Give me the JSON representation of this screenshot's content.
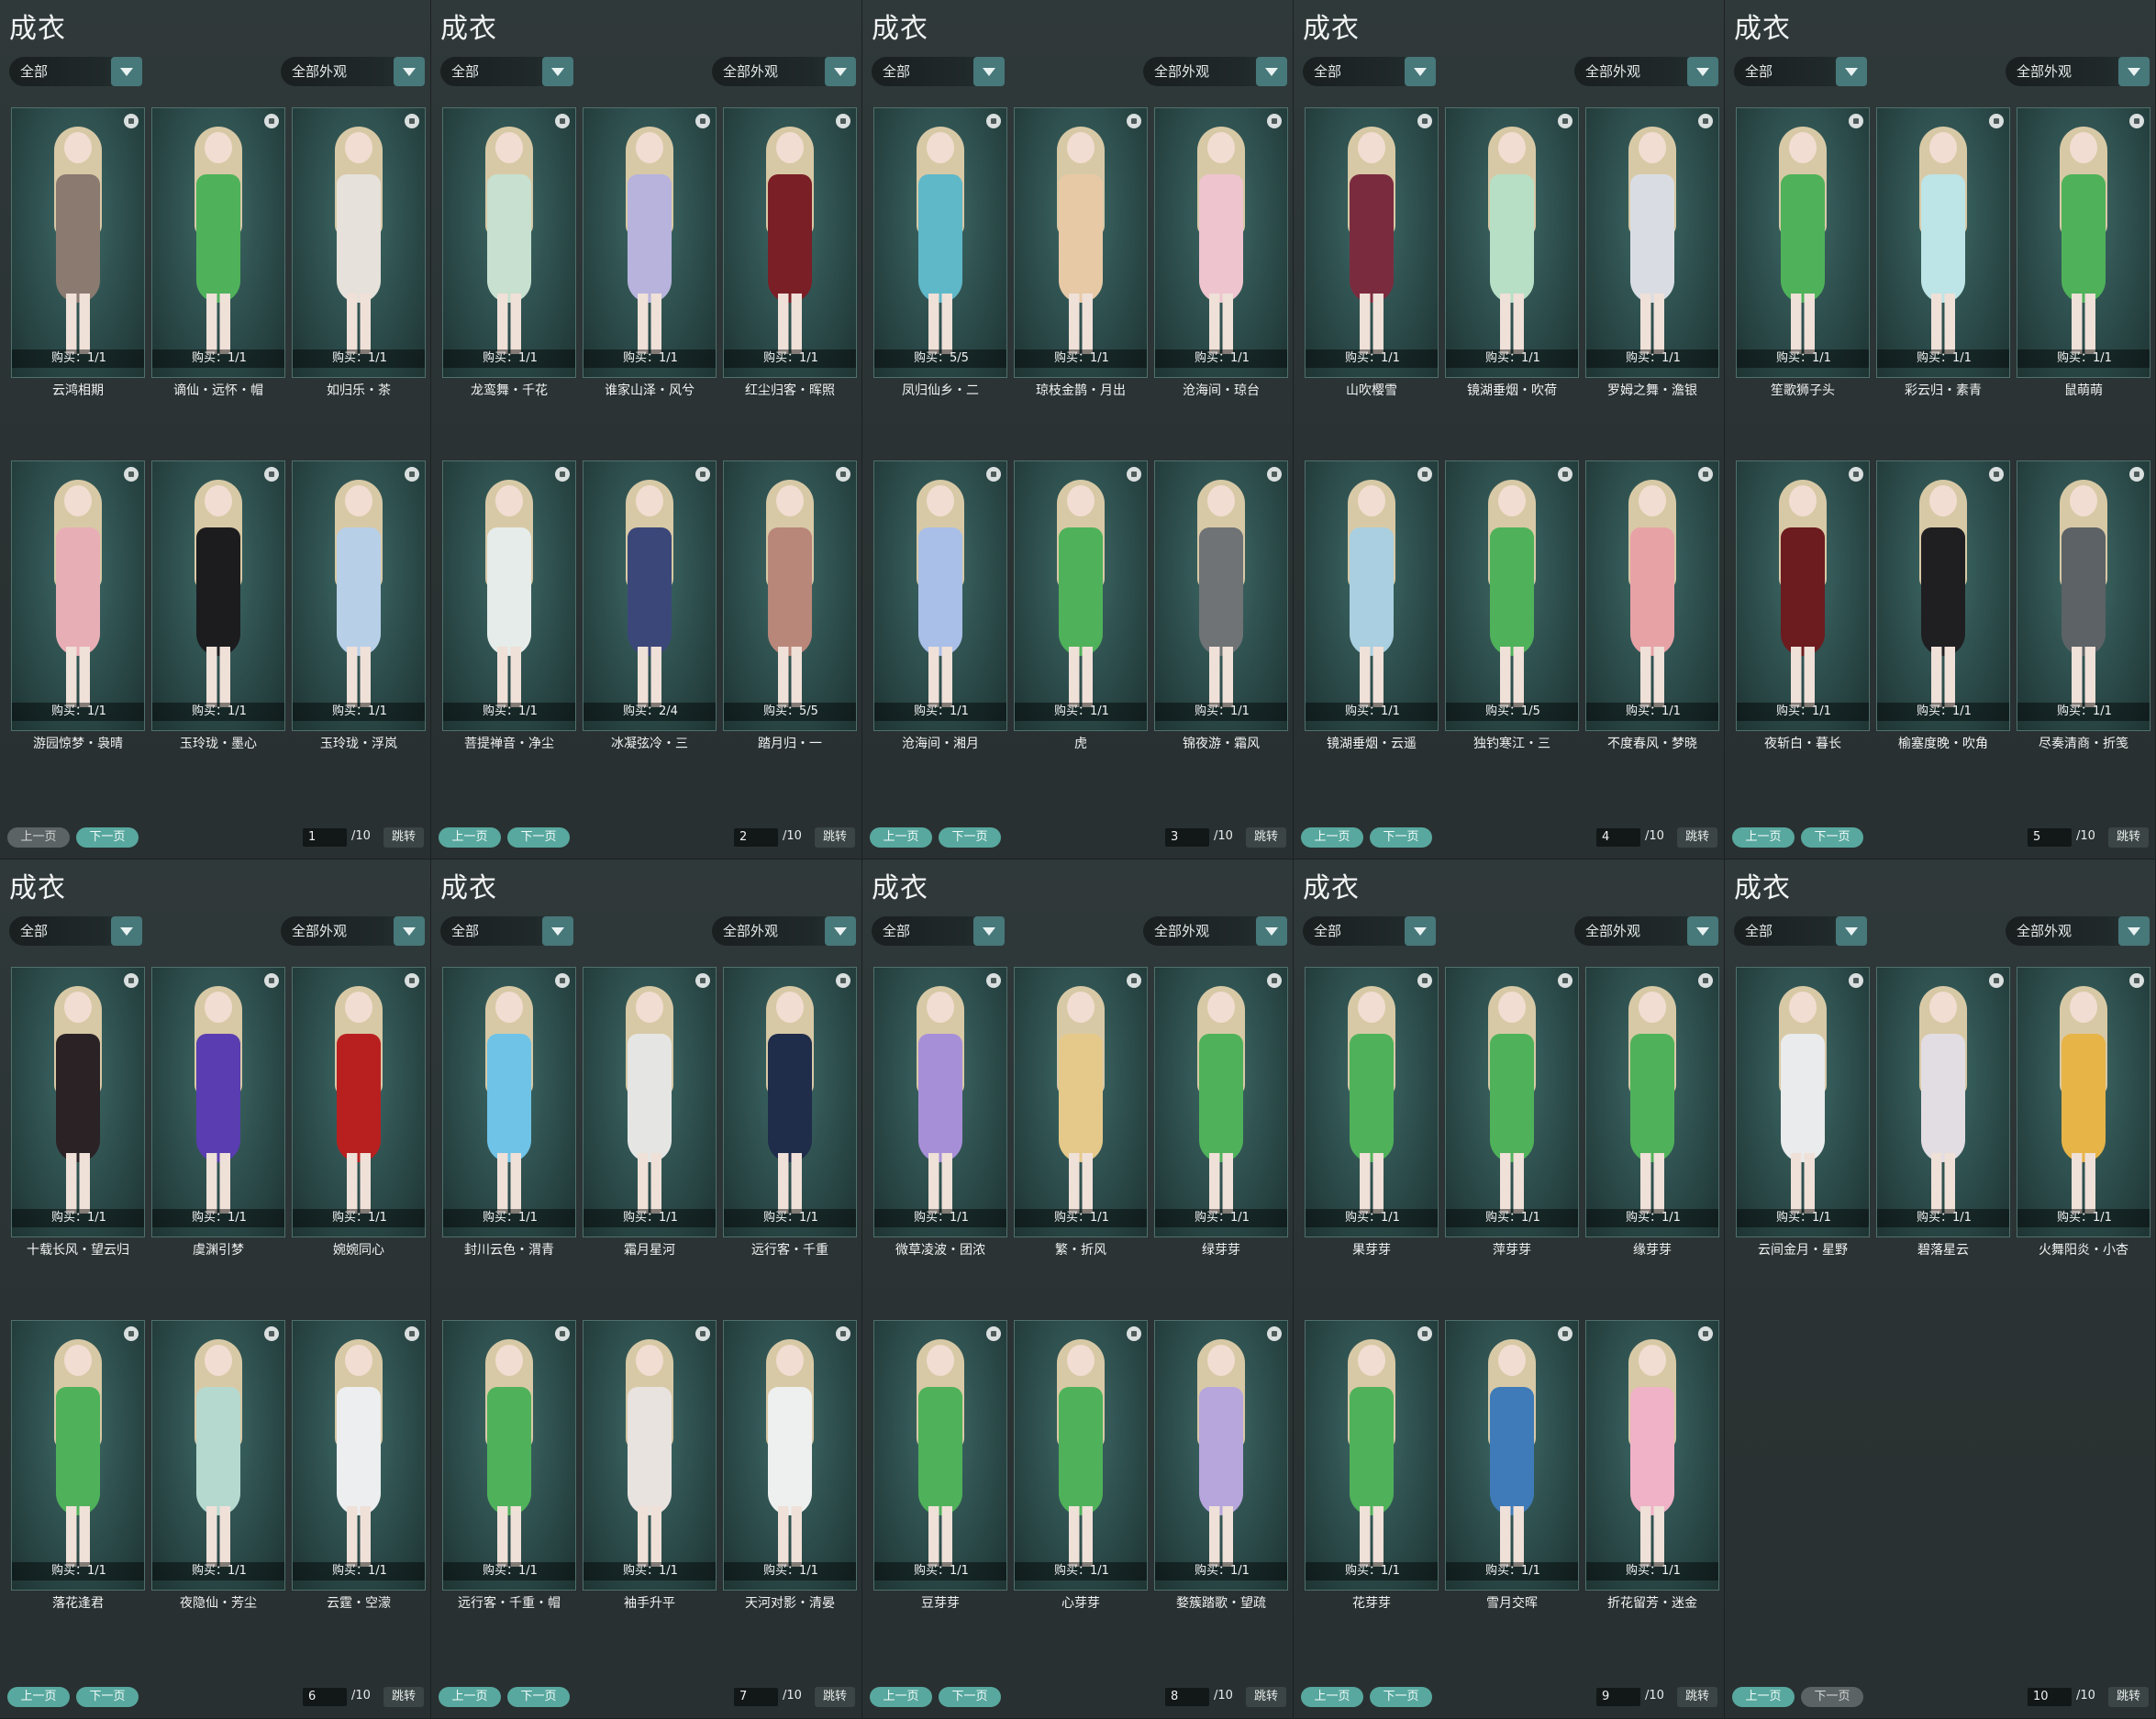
{
  "colors": {
    "accent_on": "#58a89f",
    "accent_off": "#5c6364",
    "dropdown_arrow": "#47787a"
  },
  "labels": {
    "title": "成衣",
    "filter_left": "全部",
    "filter_right": "全部外观",
    "prev": "上一页",
    "next": "下一页",
    "total": "/10",
    "jump": "跳转"
  },
  "pages": [
    {
      "page": "1",
      "prev_enabled": false,
      "next_enabled": true,
      "items": [
        {
          "name": "云鸿相期",
          "buy": "购买：1/1",
          "outfit": "#8a7a70"
        },
        {
          "name": "谪仙・远怀・帽",
          "buy": "购买：1/1",
          "outfit": "#4fb25a"
        },
        {
          "name": "如归乐・茶",
          "buy": "购买：1/1",
          "outfit": "#e6e1da"
        },
        {
          "name": "游园惊梦・袅晴",
          "buy": "购买：1/1",
          "outfit": "#e8aeb6"
        },
        {
          "name": "玉玲珑・墨心",
          "buy": "购买：1/1",
          "outfit": "#1c1c1f"
        },
        {
          "name": "玉玲珑・浮岚",
          "buy": "购买：1/1",
          "outfit": "#b8cfe8"
        }
      ]
    },
    {
      "page": "2",
      "prev_enabled": true,
      "next_enabled": true,
      "items": [
        {
          "name": "龙鸾舞・千花",
          "buy": "购买：1/1",
          "outfit": "#c8e0cf"
        },
        {
          "name": "谁家山泽・风兮",
          "buy": "购买：1/1",
          "outfit": "#b7b3dd"
        },
        {
          "name": "红尘归客・晖照",
          "buy": "购买：1/1",
          "outfit": "#7a1f25"
        },
        {
          "name": "菩提禅音・净尘",
          "buy": "购买：1/1",
          "outfit": "#e6ece9"
        },
        {
          "name": "冰凝弦冷・三",
          "buy": "购买：2/4",
          "outfit": "#3b4778"
        },
        {
          "name": "踏月归・一",
          "buy": "购买：5/5",
          "outfit": "#b9877a"
        }
      ]
    },
    {
      "page": "3",
      "prev_enabled": true,
      "next_enabled": true,
      "items": [
        {
          "name": "凤归仙乡・二",
          "buy": "购买：5/5",
          "outfit": "#5fb8c8"
        },
        {
          "name": "琼枝金鹊・月出",
          "buy": "购买：1/1",
          "outfit": "#e7c9a6"
        },
        {
          "name": "沧海间・琼台",
          "buy": "购买：1/1",
          "outfit": "#eec4cf"
        },
        {
          "name": "沧海间・湘月",
          "buy": "购买：1/1",
          "outfit": "#a9bfe8"
        },
        {
          "name": "虎",
          "buy": "购买：1/1",
          "outfit": "#4fb25a"
        },
        {
          "name": "锦夜游・霜风",
          "buy": "购买：1/1",
          "outfit": "#6f7376"
        }
      ]
    },
    {
      "page": "4",
      "prev_enabled": true,
      "next_enabled": true,
      "items": [
        {
          "name": "山吹樱雪",
          "buy": "购买：1/1",
          "outfit": "#7b2b3e"
        },
        {
          "name": "镜湖垂烟・吹荷",
          "buy": "购买：1/1",
          "outfit": "#b7dfc5"
        },
        {
          "name": "罗姆之舞・澹银",
          "buy": "购买：1/1",
          "outfit": "#d9dde3"
        },
        {
          "name": "镜湖垂烟・云遥",
          "buy": "购买：1/1",
          "outfit": "#a9cfe0"
        },
        {
          "name": "独钓寒江・三",
          "buy": "购买：1/5",
          "outfit": "#4fb25a"
        },
        {
          "name": "不度春风・梦晓",
          "buy": "购买：1/1",
          "outfit": "#e7a2a6"
        }
      ]
    },
    {
      "page": "5",
      "prev_enabled": true,
      "next_enabled": true,
      "items": [
        {
          "name": "笙歌狮子头",
          "buy": "购买：1/1",
          "outfit": "#4fb25a"
        },
        {
          "name": "彩云归・素青",
          "buy": "购买：1/1",
          "outfit": "#bde4e6"
        },
        {
          "name": "鼠萌萌",
          "buy": "购买：1/1",
          "outfit": "#4fb25a"
        },
        {
          "name": "夜斩白・暮长",
          "buy": "购买：1/1",
          "outfit": "#6c1b1f"
        },
        {
          "name": "榆塞度晚・吹角",
          "buy": "购买：1/1",
          "outfit": "#1f1f22"
        },
        {
          "name": "尽奏清商・折笺",
          "buy": "购买：1/1",
          "outfit": "#5c6266"
        }
      ]
    },
    {
      "page": "6",
      "prev_enabled": true,
      "next_enabled": true,
      "items": [
        {
          "name": "十载长风・望云归",
          "buy": "购买：1/1",
          "outfit": "#2a2225"
        },
        {
          "name": "虞渊引梦",
          "buy": "购买：1/1",
          "outfit": "#5a3db0"
        },
        {
          "name": "婉婉同心",
          "buy": "购买：1/1",
          "outfit": "#b8201f"
        },
        {
          "name": "落花逢君",
          "buy": "购买：1/1",
          "outfit": "#4fb25a"
        },
        {
          "name": "夜隐仙・芳尘",
          "buy": "购买：1/1",
          "outfit": "#b6d9cf"
        },
        {
          "name": "云霆・空濛",
          "buy": "购买：1/1",
          "outfit": "#eceeef"
        }
      ]
    },
    {
      "page": "7",
      "prev_enabled": true,
      "next_enabled": true,
      "items": [
        {
          "name": "封川云色・渭青",
          "buy": "购买：1/1",
          "outfit": "#6fc3e6"
        },
        {
          "name": "霜月星河",
          "buy": "购买：1/1",
          "outfit": "#e5e6e4"
        },
        {
          "name": "远行客・千重",
          "buy": "购买：1/1",
          "outfit": "#1f2c4a"
        },
        {
          "name": "远行客・千重・帽",
          "buy": "购买：1/1",
          "outfit": "#4fb25a"
        },
        {
          "name": "袖手升平",
          "buy": "购买：1/1",
          "outfit": "#e9e3df"
        },
        {
          "name": "天河对影・清晏",
          "buy": "购买：1/1",
          "outfit": "#eef0ef"
        }
      ]
    },
    {
      "page": "8",
      "prev_enabled": true,
      "next_enabled": true,
      "items": [
        {
          "name": "微草凌波・团浓",
          "buy": "购买：1/1",
          "outfit": "#a78fd8"
        },
        {
          "name": "繁・折风",
          "buy": "购买：1/1",
          "outfit": "#e4c98a"
        },
        {
          "name": "绿芽芽",
          "buy": "购买：1/1",
          "outfit": "#4fb25a"
        },
        {
          "name": "豆芽芽",
          "buy": "购买：1/1",
          "outfit": "#4fb25a"
        },
        {
          "name": "心芽芽",
          "buy": "购买：1/1",
          "outfit": "#4fb25a"
        },
        {
          "name": "婺簇踏歌・望疏",
          "buy": "购买：1/1",
          "outfit": "#b6a6dc"
        }
      ]
    },
    {
      "page": "9",
      "prev_enabled": true,
      "next_enabled": true,
      "items": [
        {
          "name": "果芽芽",
          "buy": "购买：1/1",
          "outfit": "#4fb25a"
        },
        {
          "name": "萍芽芽",
          "buy": "购买：1/1",
          "outfit": "#4fb25a"
        },
        {
          "name": "缘芽芽",
          "buy": "购买：1/1",
          "outfit": "#4fb25a"
        },
        {
          "name": "花芽芽",
          "buy": "购买：1/1",
          "outfit": "#4fb25a"
        },
        {
          "name": "雪月交晖",
          "buy": "购买：1/1",
          "outfit": "#3f7bb8"
        },
        {
          "name": "折花留芳・迷金",
          "buy": "购买：1/1",
          "outfit": "#efb2c6"
        }
      ]
    },
    {
      "page": "10",
      "prev_enabled": true,
      "next_enabled": false,
      "items": [
        {
          "name": "云间金月・星野",
          "buy": "购买：1/1",
          "outfit": "#e9ebec"
        },
        {
          "name": "碧落星云",
          "buy": "购买：1/1",
          "outfit": "#e2dde3"
        },
        {
          "name": "火舞阳炎・小杏",
          "buy": "购买：1/1",
          "outfit": "#e7b448"
        }
      ]
    }
  ]
}
